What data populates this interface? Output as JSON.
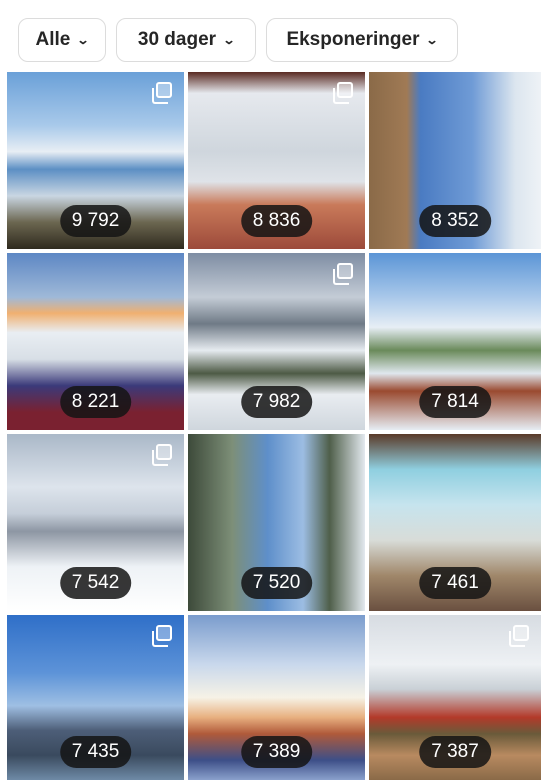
{
  "filters": [
    {
      "label": "Alle",
      "icon": "chevron-down-icon"
    },
    {
      "label": "30 dager",
      "icon": "chevron-down-icon"
    },
    {
      "label": "Eksponeringer",
      "icon": "chevron-down-icon"
    }
  ],
  "posts": [
    {
      "count": "9 792",
      "multi": true
    },
    {
      "count": "8 836",
      "multi": true
    },
    {
      "count": "8 352",
      "multi": false
    },
    {
      "count": "8 221",
      "multi": false
    },
    {
      "count": "7 982",
      "multi": true
    },
    {
      "count": "7 814",
      "multi": false
    },
    {
      "count": "7 542",
      "multi": true
    },
    {
      "count": "7 520",
      "multi": false
    },
    {
      "count": "7 461",
      "multi": false
    },
    {
      "count": "7 435",
      "multi": true
    },
    {
      "count": "7 389",
      "multi": false
    },
    {
      "count": "7 387",
      "multi": true
    }
  ]
}
